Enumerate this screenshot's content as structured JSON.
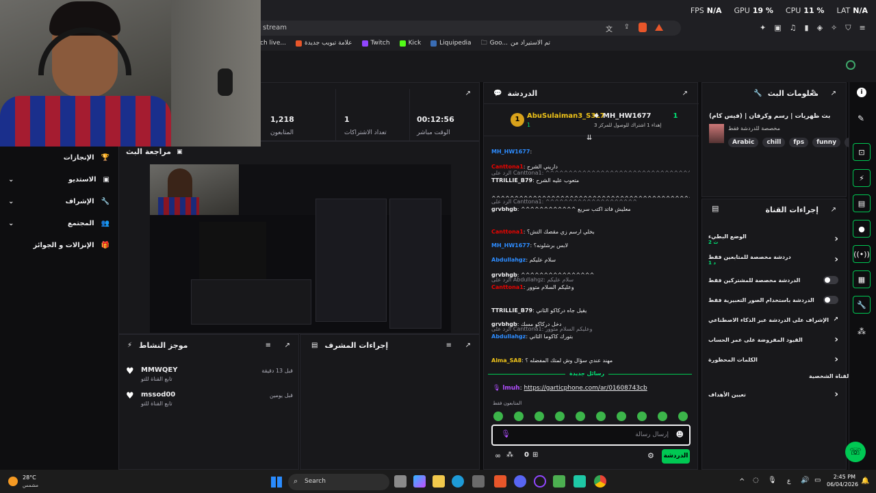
{
  "overlay": {
    "fps_label": "FPS",
    "fps_value": "N/A",
    "gpu_label": "GPU",
    "gpu_value": "19 %",
    "cpu_label": "CPU",
    "cpu_value": "11 %",
    "lat_label": "LAT",
    "lat_value": "N/A"
  },
  "browser": {
    "url_text": "stream",
    "bookmarks": [
      {
        "label": "ch live..."
      },
      {
        "label": "علامة تبويب جديدة"
      },
      {
        "label": "Twitch"
      },
      {
        "label": "Kick"
      },
      {
        "label": "Liquipedia"
      },
      {
        "label": "Goo..."
      },
      {
        "label": "تم الاستيراد من"
      }
    ]
  },
  "nav": {
    "items": [
      {
        "label": "الإنجازات",
        "icon": "trophy-icon"
      },
      {
        "label": "الاستديو",
        "icon": "studio-icon"
      },
      {
        "label": "الإشراف",
        "icon": "wrench-icon"
      },
      {
        "label": "المجتمع",
        "icon": "community-icon"
      },
      {
        "label": "الإنزالات و الجوائز",
        "icon": "gift-icon"
      }
    ]
  },
  "stats": [
    {
      "value": "1,218",
      "label": "المتابعون"
    },
    {
      "value": "1",
      "label": "تعداد الاشتراكات"
    },
    {
      "value": "00:12:56",
      "label": "الوقت مباشر"
    }
  ],
  "preview": {
    "title": "مراجعة البث"
  },
  "activity": {
    "title": "موجز النشاط",
    "items": [
      {
        "name": "MMWQEY",
        "action": "تابع القناة للتو",
        "time": "قبل 13 دقيقة"
      },
      {
        "name": "mssod00",
        "action": "تابع القناة للتو",
        "time": "قبل يومين"
      }
    ]
  },
  "mod_actions": {
    "title": "إجراءات المشرف"
  },
  "chat": {
    "title": "الدردشة",
    "leader1_name": "AbuSulaiman3_S3L7",
    "leader1_count": "1",
    "leader2_name": "MH_HW1677",
    "leader2_count": "1",
    "leader2_sub": "إهداء 1 اشتراك للوصول للمركز 3",
    "messages": [
      {
        "user": "MH_HW1677",
        "text": "",
        "color": "#2d8cff"
      },
      {
        "user": "Canttona1",
        "text": "داريني الشرح",
        "color": "#eb0400"
      },
      {
        "reply": "الرد على Canttona1: ^^^^^^^^^^^^^^^^^^^^^^^^^^^^^^^^^^^^^^^^^^^^^^^^^^^^^^^",
        "user": "TTRILLIE_B79",
        "text": "متعوب عليه الشرح",
        "color": "#efeff1"
      },
      {
        "user": "",
        "text": "^^^^^^^^^^^^^^^^^^^^^^^^^^^^^^^^^^^^^^^^^^^^^^^^",
        "color": "#efeff1"
      },
      {
        "reply": "الرد على Canttona1: ^^^^^^^^^^^^^^^^^^^^",
        "user": "grvbhgb",
        "text": "^^^^^^^^^^^^ معليش فاتد اكتب سريع",
        "color": "#efeff1"
      },
      {
        "user": "Canttona1",
        "text": "بخلي ارسم زي مقصك التش؟",
        "color": "#eb0400"
      },
      {
        "user": "MH_HW1677",
        "text": "لابس برشلونه؟",
        "color": "#2d8cff"
      },
      {
        "user": "Abdullahgz",
        "text": "سلام عليكم",
        "color": "#2d8cff"
      },
      {
        "user": "grvbhgb",
        "text": "^^^^^^^^^^^^^^^^",
        "color": "#efeff1"
      },
      {
        "reply": "الرد على Abdullahgz: سلام عليكم",
        "user": "Canttona1",
        "text": "وعليكم السلام متوور",
        "color": "#eb0400"
      },
      {
        "user": "TTRILLIE_B79",
        "text": "يقيل جاه دركاكو الثاني",
        "color": "#efeff1"
      },
      {
        "user": "grvbhgb",
        "text": "دخل دركاكو مسك",
        "color": "#efeff1"
      },
      {
        "reply": "الرد على Canttona1: وعليكم السلام متوور",
        "user": "Abdullahgz",
        "text": "بتورك كاكوما الثاني",
        "color": "#2d8cff"
      },
      {
        "user": "Alma_SA8",
        "text": "مهند عندي سؤال وش لمتك المفضله ؟",
        "color": "#f0c419"
      }
    ],
    "new_messages": "رسائل جديدة",
    "link_user": "lmuh",
    "link_text": "https://garticphone.com/ar/01608743cb",
    "followers_only": "المتابعون فقط",
    "input_placeholder": "إرسال رسالة",
    "send_button": "الدردشة",
    "points": "0"
  },
  "stream_info": {
    "title": "معلومات البث",
    "stream_title": "بث ظهريات | رسم وكرفان | (فيس كام)",
    "category": "مخصصة للدردشة فقط",
    "tags": [
      "Arabic",
      "chill",
      "fps",
      "funny",
      "g"
    ]
  },
  "channel_actions": {
    "title": "إجراءات القناة",
    "items": [
      {
        "label": "الوضع البطيء",
        "sub": "2 ث",
        "control": "chevron"
      },
      {
        "label": "دردشة مخصصة للمتابعين فقط",
        "sub": "1 د",
        "control": "chevron"
      },
      {
        "label": "الدردشة مخصصة للمشتركين فقط",
        "sub": "",
        "control": "toggle"
      },
      {
        "label": "الدردشة باستخدام الصور التعبيرية فقط",
        "sub": "",
        "control": "toggle"
      },
      {
        "label": "الإشراف على الدردشة عبر الذكاء الاصطناعي",
        "sub": "",
        "control": "external"
      },
      {
        "label": "القيود المفروضة على عمر الحساب",
        "sub": "",
        "control": "chevron"
      },
      {
        "label": "الكلمات المحظورة",
        "sub": "",
        "control": "chevron"
      }
    ],
    "section_label": "القناة الشخصية",
    "goals_label": "تعيين الأهداف"
  },
  "taskbar": {
    "weather_temp": "28°C",
    "weather_desc": "مشمس",
    "search_label": "Search",
    "lang": "ع",
    "time": "2:45 PM",
    "date": "06/04/2026"
  }
}
